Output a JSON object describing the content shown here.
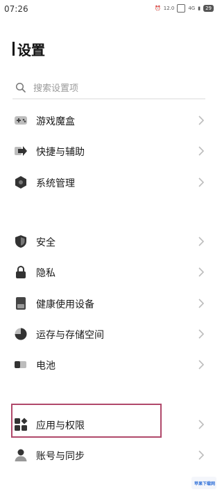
{
  "status_bar": {
    "time": "07:26",
    "speed": "12.0",
    "network": "4G",
    "battery": "29"
  },
  "header": {
    "title": "设置"
  },
  "search": {
    "placeholder": "搜索设置项"
  },
  "groups": [
    [
      {
        "label": "游戏魔盒",
        "icon": "gamepad-icon"
      },
      {
        "label": "快捷与辅助",
        "icon": "shortcut-arrow-icon"
      },
      {
        "label": "系统管理",
        "icon": "hexagon-icon"
      }
    ],
    [
      {
        "label": "安全",
        "icon": "shield-icon"
      },
      {
        "label": "隐私",
        "icon": "lock-icon"
      },
      {
        "label": "健康使用设备",
        "icon": "hourglass-icon"
      },
      {
        "label": "运存与存储空间",
        "icon": "pie-chart-icon"
      },
      {
        "label": "电池",
        "icon": "battery-icon"
      }
    ],
    [
      {
        "label": "应用与权限",
        "icon": "apps-grid-icon"
      },
      {
        "label": "账号与同步",
        "icon": "account-icon"
      }
    ]
  ],
  "watermark": "苹果下载网",
  "colors": {
    "highlight_border": "#b0486a",
    "icon": "#333333",
    "chevron": "#bdbdbd"
  }
}
